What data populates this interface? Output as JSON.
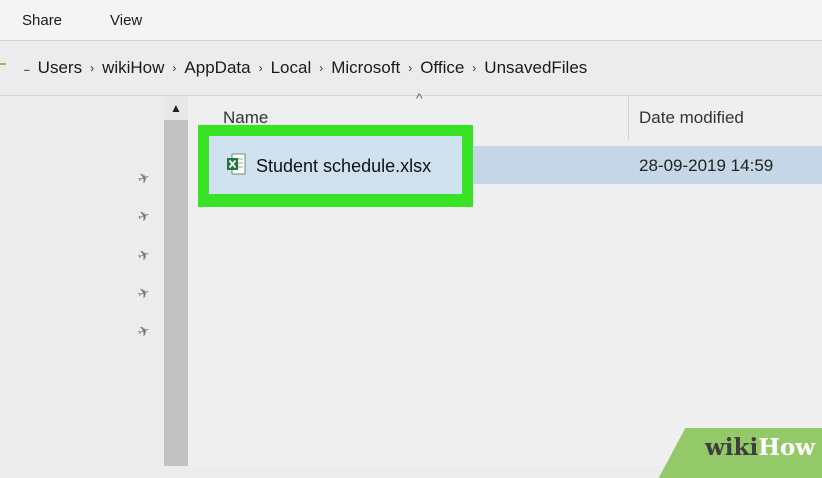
{
  "ribbon": {
    "tabs": [
      "Share",
      "View"
    ]
  },
  "address_bar": {
    "path": [
      "Users",
      "wikiHow",
      "AppData",
      "Local",
      "Microsoft",
      "Office",
      "UnsavedFiles"
    ],
    "separator": "›"
  },
  "columns": {
    "name": "Name",
    "date_modified": "Date modified"
  },
  "files": [
    {
      "name": "Student schedule.xlsx",
      "date_modified": "28-09-2019 14:59",
      "icon": "excel-file-icon",
      "selected": true
    }
  ],
  "quick_access_pins": 5,
  "highlight_color": "#37e324",
  "selection_color": "#c5d7e6",
  "watermark": {
    "part1": "wiki",
    "part2": "How"
  }
}
